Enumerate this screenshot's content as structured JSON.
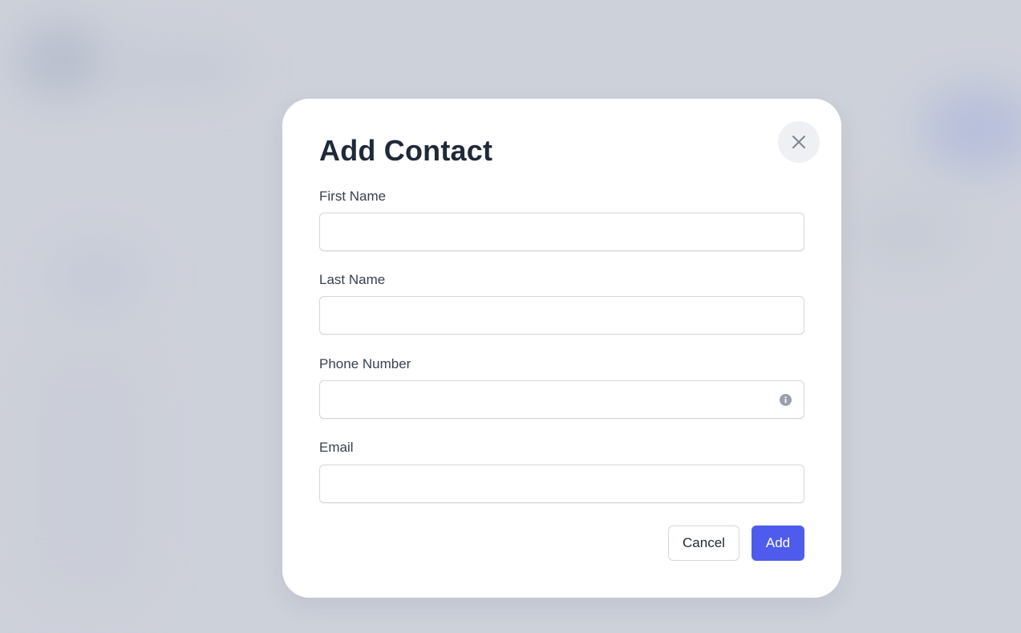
{
  "modal": {
    "title": "Add Contact",
    "close_icon": "close-icon",
    "fields": [
      {
        "label": "First Name",
        "value": "",
        "placeholder": ""
      },
      {
        "label": "Last Name",
        "value": "",
        "placeholder": ""
      },
      {
        "label": "Phone Number",
        "value": "",
        "placeholder": "",
        "icon": "info-icon"
      },
      {
        "label": "Email",
        "value": "",
        "placeholder": ""
      }
    ],
    "actions": {
      "cancel_label": "Cancel",
      "add_label": "Add"
    }
  },
  "colors": {
    "backdrop": "#cdd1da",
    "primary": "#4f5bec",
    "title_text": "#1f2937",
    "close_bg": "#eef0f3"
  }
}
